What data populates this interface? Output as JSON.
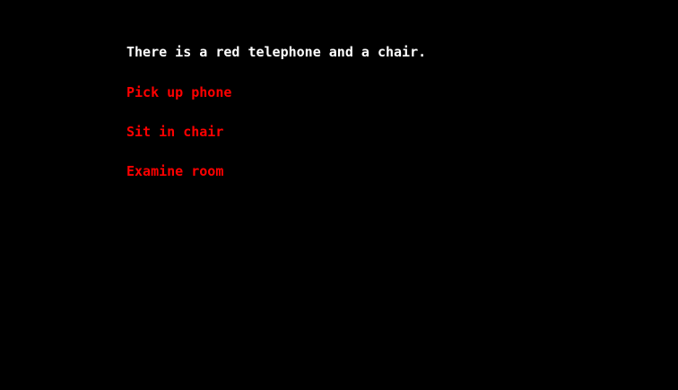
{
  "colors": {
    "background": "#000000",
    "narration_text": "#ffffff",
    "choice_text": "#ff0000"
  },
  "scene": {
    "narration": "There is a red telephone and a chair."
  },
  "choices": [
    {
      "label": "Pick up phone"
    },
    {
      "label": "Sit in chair"
    },
    {
      "label": "Examine room"
    }
  ]
}
